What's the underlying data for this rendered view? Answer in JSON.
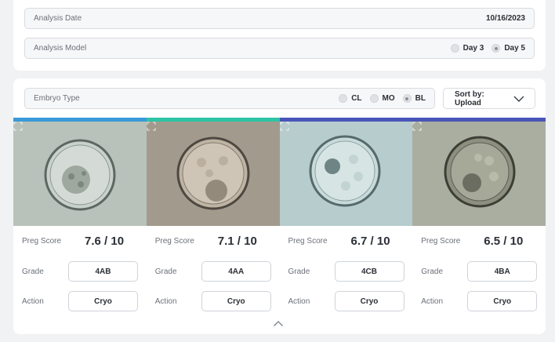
{
  "analysis": {
    "date_label": "Analysis Date",
    "date_value": "10/16/2023",
    "model_label": "Analysis Model",
    "model_options": [
      {
        "label": "Day 3",
        "selected": false
      },
      {
        "label": "Day 5",
        "selected": true
      }
    ]
  },
  "filters": {
    "embryo_type_label": "Embryo Type",
    "embryo_types": [
      {
        "label": "CL",
        "selected": false
      },
      {
        "label": "MO",
        "selected": false
      },
      {
        "label": "BL",
        "selected": true
      }
    ],
    "sort_label": "Sort by: Upload"
  },
  "embryos": [
    {
      "color": "#3a9ad8",
      "preg_label": "Preg Score",
      "preg_score": "7.6 / 10",
      "grade_label": "Grade",
      "grade": "4AB",
      "action_label": "Action",
      "action": "Cryo"
    },
    {
      "color": "#2ec4a6",
      "preg_label": "Preg Score",
      "preg_score": "7.1 / 10",
      "grade_label": "Grade",
      "grade": "4AA",
      "action_label": "Action",
      "action": "Cryo"
    },
    {
      "color": "#4a55b8",
      "preg_label": "Preg Score",
      "preg_score": "6.7 / 10",
      "grade_label": "Grade",
      "grade": "4CB",
      "action_label": "Action",
      "action": "Cryo"
    },
    {
      "color": "#4a55b8",
      "preg_label": "Preg Score",
      "preg_score": "6.5 / 10",
      "grade_label": "Grade",
      "grade": "4BA",
      "action_label": "Action",
      "action": "Cryo"
    }
  ],
  "icons": {
    "sort": "chevron-down-icon",
    "expand": "expand-icon",
    "collapse": "chevron-up-icon"
  }
}
